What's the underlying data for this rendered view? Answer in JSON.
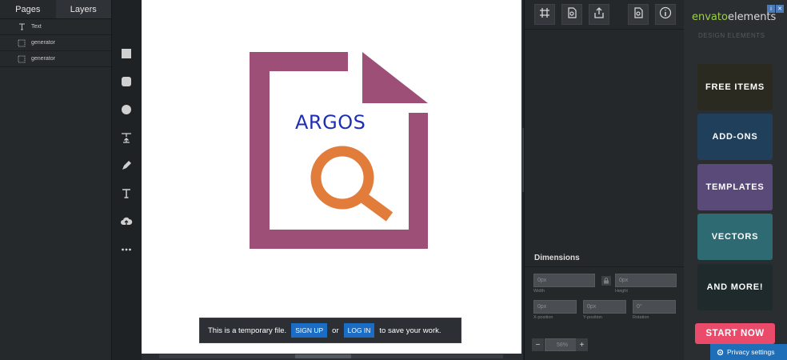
{
  "left_panel": {
    "tabs": [
      {
        "label": "Pages"
      },
      {
        "label": "Layers"
      }
    ],
    "layers": [
      {
        "label": "Text",
        "icon": "text-icon"
      },
      {
        "label": "generator",
        "icon": "image-placeholder-icon"
      },
      {
        "label": "generator",
        "icon": "image-placeholder-icon"
      }
    ]
  },
  "tools": [
    "square-icon",
    "rounded-square-icon",
    "circle-icon",
    "text-upload-icon",
    "pencil-icon",
    "text-icon",
    "cloud-upload-icon",
    "more-icon"
  ],
  "canvas": {
    "logo_text": "ARGOS",
    "colors": {
      "frame": "#9e4f78",
      "magnifier": "#e27c3a",
      "text": "#1f2fb5"
    }
  },
  "toast": {
    "message": "This is a temporary file.",
    "signup_label": "SIGN UP",
    "or_text": "or",
    "login_label": "LOG IN",
    "suffix": "to save your work."
  },
  "properties": {
    "toolbar": [
      "grid-icon",
      "page-settings-icon",
      "share-icon",
      "page-settings-icon",
      "info-icon"
    ],
    "dimensions_title": "Dimensions",
    "width": {
      "value": "0px",
      "label": "Width"
    },
    "height": {
      "value": "0px",
      "label": "Height"
    },
    "x": {
      "value": "0px",
      "label": "X-position"
    },
    "y": {
      "value": "0px",
      "label": "Y-position"
    },
    "rotation": {
      "value": "0°",
      "label": "Rotation"
    },
    "zoom": "58%"
  },
  "ad": {
    "brand_part1": "envato",
    "brand_part2": "elements",
    "tagline": "DESIGN ELEMENTS",
    "tiles": [
      {
        "label": "FREE ITEMS",
        "color": "#2b2a20"
      },
      {
        "label": "ADD-ONS",
        "color": "#203f5a"
      },
      {
        "label": "TEMPLATES",
        "color": "#5a4a7a"
      },
      {
        "label": "VECTORS",
        "color": "#2d6a72"
      },
      {
        "label": "AND MORE!",
        "color": "#1f2a2d"
      }
    ],
    "cta": "START NOW",
    "privacy": "Privacy settings"
  }
}
